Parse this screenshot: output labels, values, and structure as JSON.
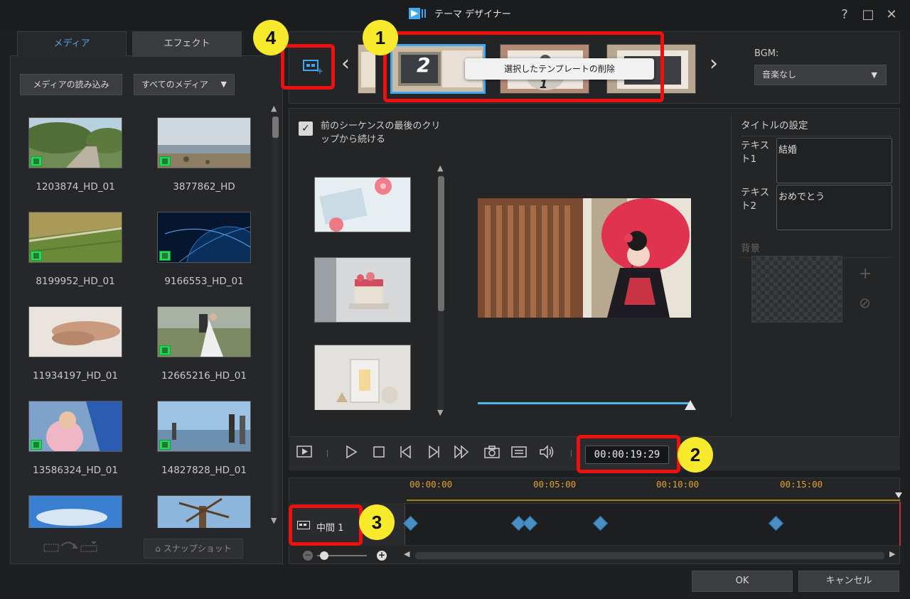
{
  "window": {
    "title": "テーマ デザイナー",
    "help": "?",
    "maximize": "□",
    "close": "✕"
  },
  "media_panel": {
    "tabs": [
      "メディア",
      "エフェクト"
    ],
    "import_label": "メディアの読み込み",
    "filter_value": "すべてのメディア",
    "items": [
      "1203874_HD_01",
      "3877862_HD",
      "8199952_HD_01",
      "9166553_HD_01",
      "11934197_HD_01",
      "12665216_HD_01",
      "13586324_HD_01",
      "14827828_HD_01"
    ],
    "snapshot_label": "スナップショット"
  },
  "templates": {
    "tooltip": "選択したテンプレートの削除",
    "numbers": [
      "2",
      "1"
    ],
    "bgm_label": "BGM:",
    "bgm_value": "音楽なし"
  },
  "editor": {
    "continue_label": "前のシーケンスの最後のクリップから続ける",
    "continue_checked": true
  },
  "title_settings": {
    "heading": "タイトルの設定",
    "text1_label": "テキスト1",
    "text1_value": "結婚",
    "text2_label": "テキスト2",
    "text2_value": "おめでとう",
    "background_heading": "背景"
  },
  "transport": {
    "timecode": "00:00:19:29"
  },
  "timeline": {
    "ticks": [
      "00:00:00",
      "00:05:00",
      "00:10:00",
      "00:15:00"
    ],
    "track_label": "中間 1"
  },
  "buttons": {
    "ok": "OK",
    "cancel": "キャンセル"
  },
  "callouts": [
    "1",
    "2",
    "3",
    "4"
  ],
  "colors": {
    "accent": "#3fa8f0",
    "callout_red": "#ee0f0f",
    "callout_yellow": "#f7ea2d",
    "timeline_gold": "#e0a32a"
  }
}
